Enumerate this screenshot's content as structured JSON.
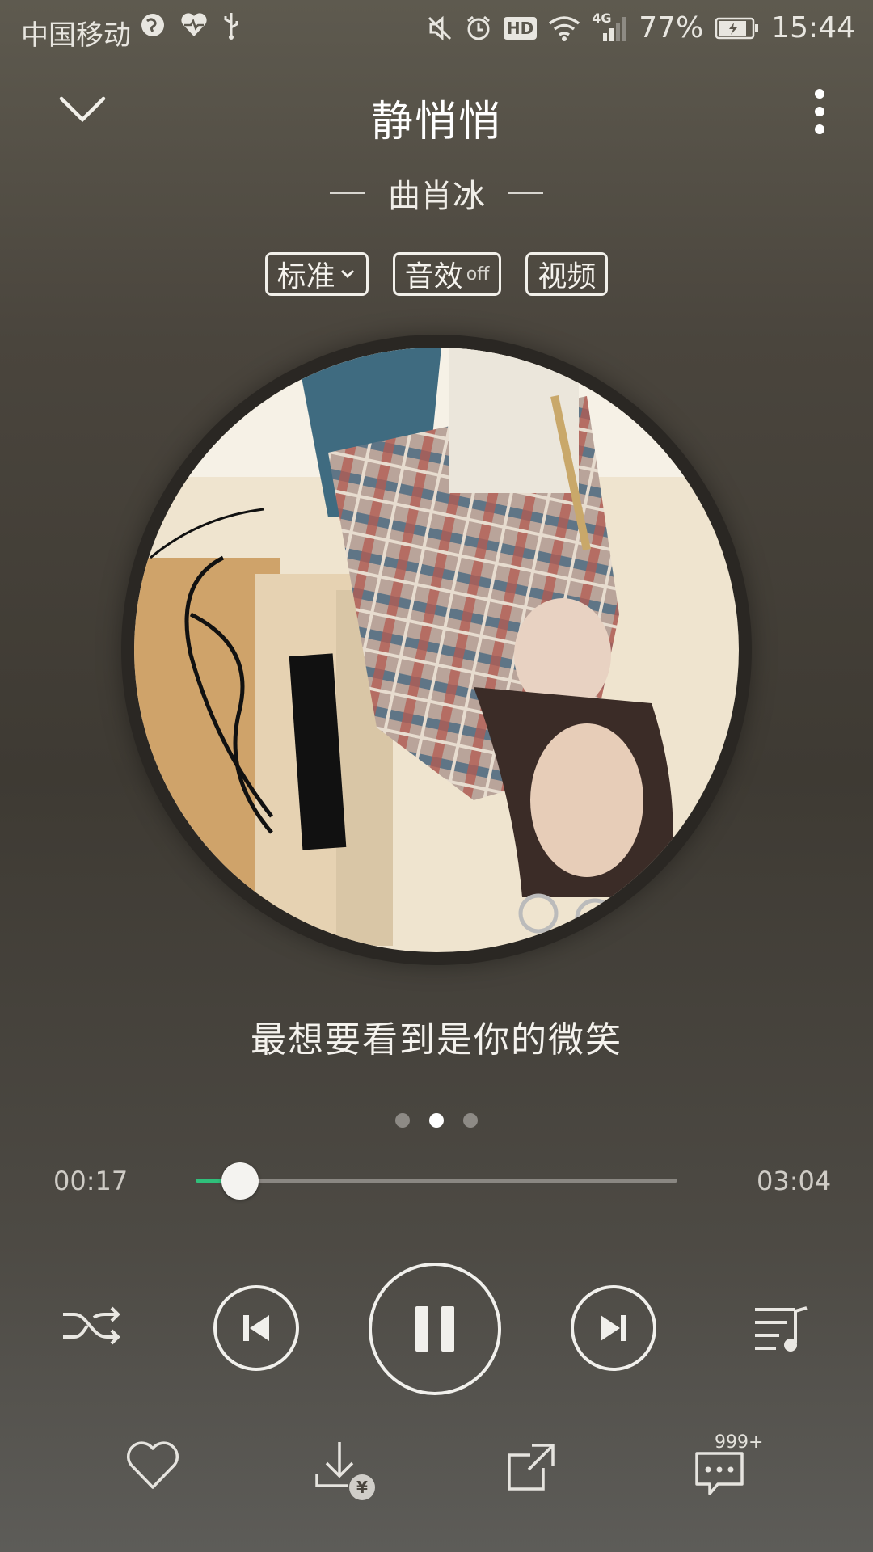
{
  "status_bar": {
    "carrier": "中国移动",
    "network": "4G",
    "hd": "HD",
    "battery": "77%",
    "time": "15:44"
  },
  "header": {
    "title": "静悄悄",
    "artist": "曲肖冰"
  },
  "options": {
    "quality": "标准",
    "effect": "音效",
    "effect_state": "off",
    "video": "视频"
  },
  "lyric": "最想要看到是你的微笑",
  "pager": {
    "count": 3,
    "active": 1
  },
  "progress": {
    "current": "00:17",
    "total": "03:04",
    "fraction": 0.092
  },
  "comments": {
    "count": "999+"
  },
  "colors": {
    "accent": "#2fc07b",
    "background": "#4a453d"
  },
  "icons": [
    "collapse-chevron-icon",
    "more-icon",
    "shuffle-icon",
    "previous-icon",
    "pause-icon",
    "next-icon",
    "playlist-icon",
    "heart-icon",
    "download-icon",
    "share-icon",
    "comment-icon"
  ]
}
